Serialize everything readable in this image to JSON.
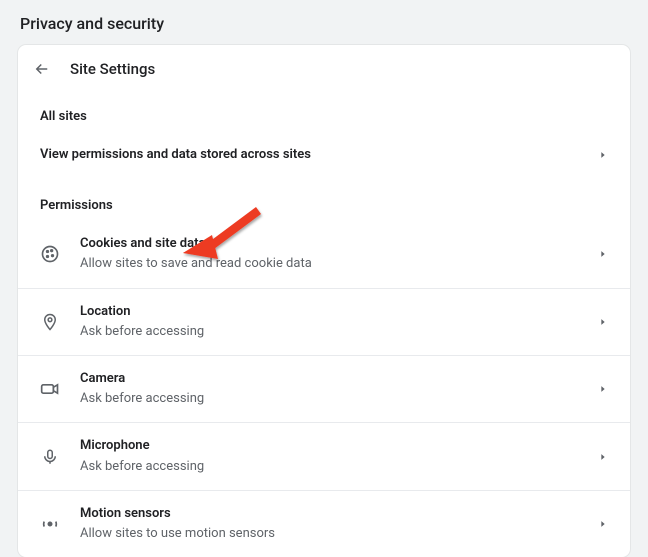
{
  "page": {
    "title": "Privacy and security"
  },
  "header": {
    "subtitle": "Site Settings"
  },
  "all_sites": {
    "label": "All sites",
    "view_permissions": "View permissions and data stored across sites"
  },
  "permissions": {
    "label": "Permissions",
    "items": [
      {
        "title": "Cookies and site data",
        "subtitle": "Allow sites to save and read cookie data",
        "icon": "cookie-icon"
      },
      {
        "title": "Location",
        "subtitle": "Ask before accessing",
        "icon": "location-icon"
      },
      {
        "title": "Camera",
        "subtitle": "Ask before accessing",
        "icon": "camera-icon"
      },
      {
        "title": "Microphone",
        "subtitle": "Ask before accessing",
        "icon": "microphone-icon"
      },
      {
        "title": "Motion sensors",
        "subtitle": "Allow sites to use motion sensors",
        "icon": "motion-icon"
      }
    ]
  }
}
